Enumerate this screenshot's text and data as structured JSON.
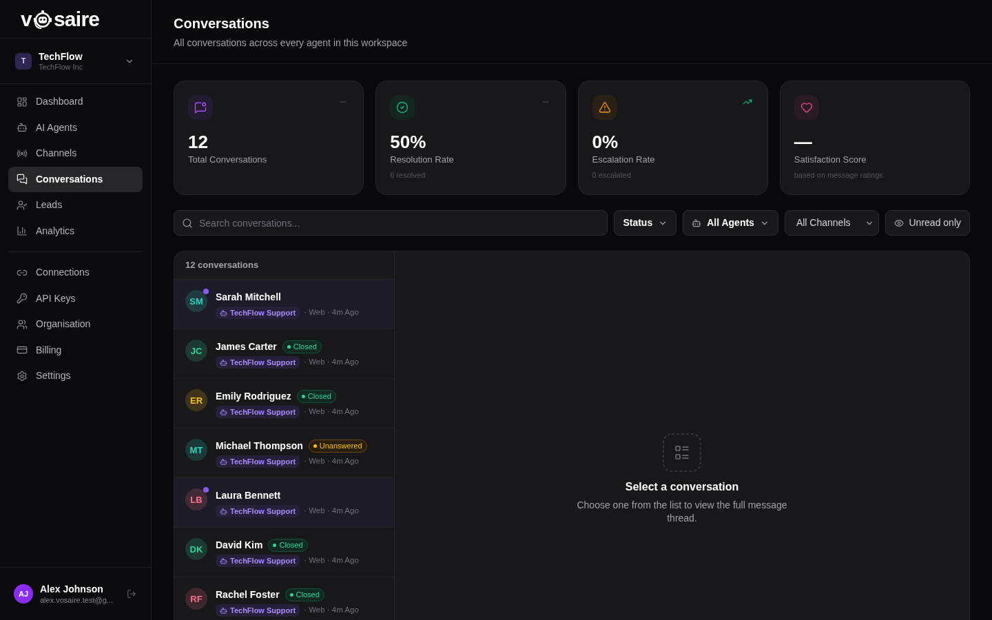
{
  "sidebar": {
    "logo": {
      "before_icon": "v",
      "after_icon": "saire"
    },
    "workspace": {
      "initial": "T",
      "name": "TechFlow",
      "org": "TechFlow Inc"
    },
    "nav_groups": [
      {
        "items": [
          {
            "label": "Dashboard",
            "selected": false
          },
          {
            "label": "AI Agents",
            "selected": false
          },
          {
            "label": "Channels",
            "selected": false
          },
          {
            "label": "Conversations",
            "selected": true
          },
          {
            "label": "Leads",
            "selected": false
          },
          {
            "label": "Analytics",
            "selected": false
          }
        ]
      },
      {
        "items": [
          {
            "label": "Connections",
            "selected": false
          },
          {
            "label": "API Keys",
            "selected": false
          },
          {
            "label": "Organisation",
            "selected": false
          },
          {
            "label": "Billing",
            "selected": false
          },
          {
            "label": "Settings",
            "selected": false
          }
        ]
      }
    ],
    "user": {
      "initials": "AJ",
      "name": "Alex Johnson",
      "email": "alex.vosaire.test@g..."
    }
  },
  "header": {
    "title": "Conversations",
    "subtitle": "All conversations across every agent in this workspace"
  },
  "stats": [
    {
      "kind": "flat",
      "value": "12",
      "label": "Total Conversations"
    },
    {
      "kind": "flat",
      "value": "50%",
      "label": "Resolution Rate",
      "note": "6 resolved"
    },
    {
      "kind": "up",
      "value": "0%",
      "label": "Escalation Rate",
      "note": "0 escalated"
    },
    {
      "kind": "plain",
      "value": "—",
      "label": "Satisfaction Score",
      "note": "based on message ratings"
    }
  ],
  "search": {
    "placeholder": "Search conversations..."
  },
  "filters": [
    {
      "kind": "dropdown",
      "label": "Status"
    },
    {
      "kind": "agent-dropdown",
      "label": "All Agents"
    },
    {
      "kind": "select",
      "label": "All Channels"
    },
    {
      "kind": "toggle",
      "label": "Unread only"
    }
  ],
  "conversations": {
    "count_label": "12 conversations",
    "items": [
      {
        "initials": "SM",
        "name": "Sarah Mitchell",
        "color": "#2dd4bf",
        "unread": true,
        "selected": false,
        "agent": "TechFlow Support",
        "meta": "· Web · 4m Ago"
      },
      {
        "initials": "JC",
        "name": "James Carter",
        "color": "#34d399",
        "unread": false,
        "selected": false,
        "status": {
          "kind": "closed",
          "label": "Closed"
        },
        "agent": "TechFlow Support",
        "meta": "· Web · 4m Ago"
      },
      {
        "initials": "ER",
        "name": "Emily Rodriguez",
        "color": "#fbbf24",
        "unread": false,
        "selected": false,
        "status": {
          "kind": "closed",
          "label": "Closed"
        },
        "agent": "TechFlow Support",
        "meta": "· Web · 4m Ago"
      },
      {
        "initials": "MT",
        "name": "Michael Thompson",
        "color": "#2dd4bf",
        "unread": false,
        "selected": false,
        "status": {
          "kind": "unanswered",
          "label": "Unanswered"
        },
        "agent": "TechFlow Support",
        "meta": "· Web · 4m Ago"
      },
      {
        "initials": "LB",
        "name": "Laura Bennett",
        "color": "#fb7185",
        "unread": true,
        "selected": false,
        "agent": "TechFlow Support",
        "meta": "· Web · 4m Ago"
      },
      {
        "initials": "DK",
        "name": "David Kim",
        "color": "#34d399",
        "unread": false,
        "selected": false,
        "status": {
          "kind": "closed",
          "label": "Closed"
        },
        "agent": "TechFlow Support",
        "meta": "· Web · 4m Ago"
      },
      {
        "initials": "RF",
        "name": "Rachel Foster",
        "color": "#fb7185",
        "unread": false,
        "selected": false,
        "status": {
          "kind": "closed",
          "label": "Closed"
        },
        "agent": "TechFlow Support",
        "meta": "· Web · 4m Ago"
      }
    ]
  },
  "detail": {
    "title": "Select a conversation",
    "text": "Choose one from the list to view the full message thread."
  }
}
